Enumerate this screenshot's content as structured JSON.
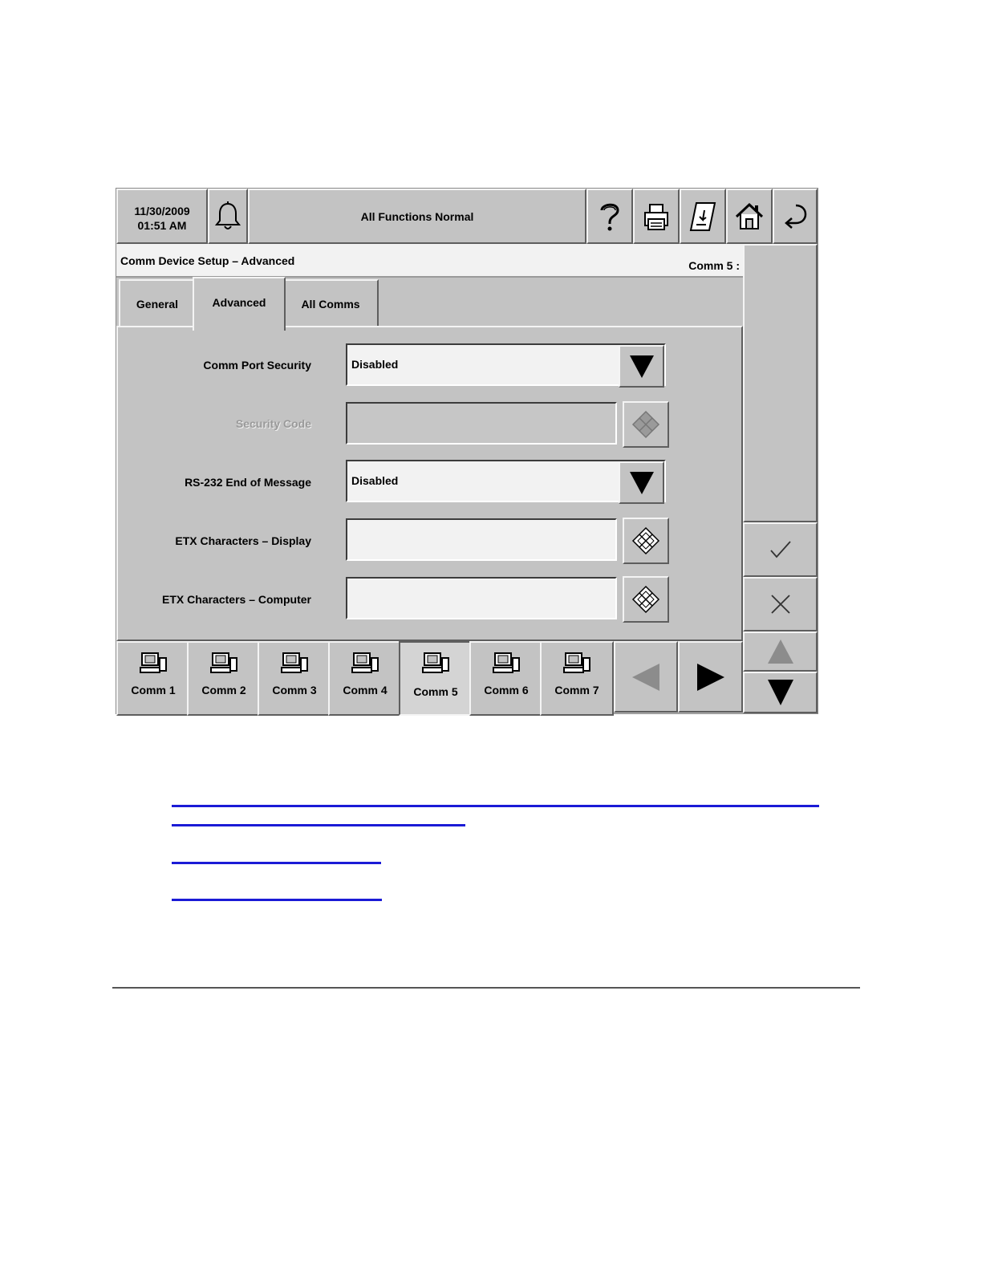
{
  "header": {
    "date": "11/30/2009",
    "time": "01:51 AM",
    "status": "All Functions Normal"
  },
  "title_bar": {
    "title": "Comm Device Setup – Advanced",
    "comm_indicator": "Comm 5 :"
  },
  "tabs": [
    {
      "label": "General",
      "active": false
    },
    {
      "label": "Advanced",
      "active": true
    },
    {
      "label": "All Comms",
      "active": false
    }
  ],
  "fields": {
    "comm_port_security": {
      "label": "Comm Port Security",
      "value": "Disabled"
    },
    "security_code": {
      "label": "Security Code",
      "value": ""
    },
    "rs232_end_of_message": {
      "label": "RS-232 End of Message",
      "value": "Disabled"
    },
    "etx_display": {
      "label": "ETX Characters – Display",
      "value": ""
    },
    "etx_computer": {
      "label": "ETX Characters – Computer",
      "value": ""
    }
  },
  "comm_buttons": [
    {
      "label": "Comm 1",
      "selected": false
    },
    {
      "label": "Comm 2",
      "selected": false
    },
    {
      "label": "Comm 3",
      "selected": false
    },
    {
      "label": "Comm 4",
      "selected": false
    },
    {
      "label": "Comm 5",
      "selected": true
    },
    {
      "label": "Comm 6",
      "selected": false
    },
    {
      "label": "Comm 7",
      "selected": false
    }
  ],
  "icons": {
    "alarm": "bell-icon",
    "help": "question-mark-icon",
    "printer": "printer-icon",
    "report": "report-icon",
    "home": "home-icon",
    "back": "return-arrow-icon",
    "ok": "check-icon",
    "cancel": "close-icon"
  },
  "colors": {
    "panel": "#c3c3c3",
    "field": "#f2f2f2",
    "link": "#1b1bd6"
  }
}
